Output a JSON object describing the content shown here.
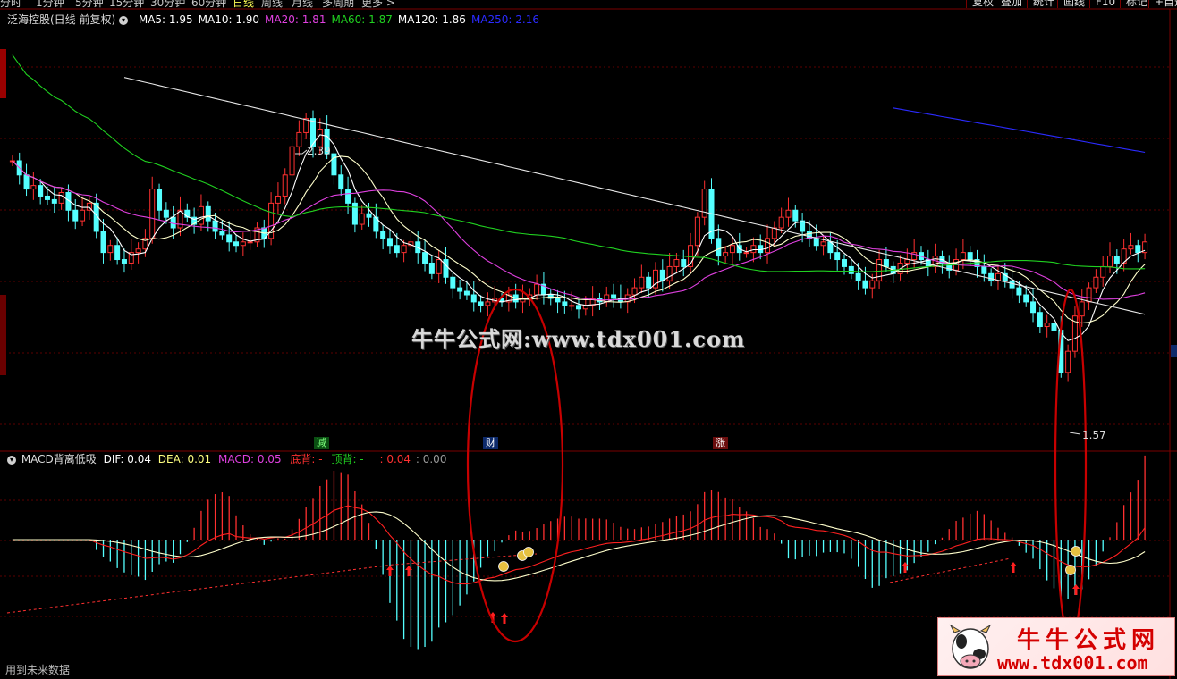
{
  "toolbar": {
    "periods": [
      "分时",
      "1分钟",
      "5分钟",
      "15分钟",
      "30分钟",
      "60分钟",
      "日线",
      "周线",
      "月线",
      "多周期",
      "更多 >"
    ],
    "active_period": "日线",
    "buttons": [
      "复权",
      "叠加",
      "统计",
      "画线",
      "F10",
      "标记",
      "+自选"
    ]
  },
  "main_panel": {
    "title": "泛海控股(日线 前复权)",
    "ma_legend": [
      {
        "label": "MA5: 1.95",
        "color": "#ffffff"
      },
      {
        "label": "MA10: 1.90",
        "color": "#ffffff"
      },
      {
        "label": "MA20: 1.81",
        "color": "#e040e0"
      },
      {
        "label": "MA60: 1.87",
        "color": "#20d020"
      },
      {
        "label": "MA120: 1.86",
        "color": "#ffffff"
      },
      {
        "label": "MA250: 2.16",
        "color": "#2b2bff"
      }
    ],
    "high_label": "2.39",
    "low_label": "1.57",
    "signals": [
      {
        "text": "减",
        "bg": "#0a4f12",
        "color": "#7dff7d"
      },
      {
        "text": "财",
        "bg": "#0d2a6b",
        "color": "#ffffff"
      },
      {
        "text": "涨",
        "bg": "#6b0d0d",
        "color": "#ffffff"
      }
    ]
  },
  "macd_panel": {
    "title": "MACD背离低吸",
    "dif": "DIF: 0.04",
    "dea": "DEA: 0.01",
    "macd": "MACD: 0.05",
    "bottom_div": "底背: -",
    "top_div": "顶背: -",
    "value_red": ": 0.04",
    "value_gray": ": 0.00"
  },
  "footer": {
    "text": "用到未来数据"
  },
  "watermark": {
    "center": "牛牛公式网:www.tdx001.com",
    "logo_title": "牛牛公式网",
    "logo_url": "www.tdx001.com"
  },
  "colors": {
    "up": "#ff3030",
    "down": "#54ffff",
    "ma5": "#ffffff",
    "ma10": "#ffffcc",
    "ma20": "#e040e0",
    "ma60": "#20d020",
    "ma120": "#e8e8e8",
    "ma250": "#2b2bff",
    "grid": "#7a0000",
    "ellipse": "#c80000"
  },
  "chart_data": {
    "type": "candlestick",
    "title": "泛海控股(日线 前复权)",
    "price_labels": {
      "high": 2.39,
      "low": 1.57
    },
    "ma_latest": {
      "MA5": 1.95,
      "MA10": 1.9,
      "MA20": 1.81,
      "MA60": 1.87,
      "MA120": 1.86,
      "MA250": 2.16
    },
    "macd_latest": {
      "DIF": 0.04,
      "DEA": 0.01,
      "MACD": 0.05
    },
    "closes": [
      2.22,
      2.18,
      2.14,
      2.15,
      2.12,
      2.11,
      2.1,
      2.13,
      2.08,
      2.05,
      2.08,
      2.1,
      2.02,
      1.96,
      1.98,
      1.94,
      1.93,
      1.96,
      1.97,
      2.0,
      2.14,
      2.08,
      2.06,
      2.03,
      2.08,
      2.06,
      2.04,
      2.09,
      2.05,
      2.02,
      2.01,
      1.99,
      1.98,
      1.99,
      1.99,
      2.03,
      2.0,
      2.1,
      2.12,
      2.18,
      2.26,
      2.3,
      2.34,
      2.26,
      2.31,
      2.24,
      2.18,
      2.14,
      2.1,
      2.04,
      2.07,
      2.06,
      2.02,
      2.0,
      1.98,
      1.96,
      1.98,
      1.99,
      1.96,
      1.93,
      1.9,
      1.94,
      1.89,
      1.86,
      1.85,
      1.84,
      1.82,
      1.81,
      1.82,
      1.83,
      1.82,
      1.84,
      1.82,
      1.83,
      1.84,
      1.87,
      1.84,
      1.83,
      1.82,
      1.81,
      1.81,
      1.8,
      1.81,
      1.83,
      1.82,
      1.84,
      1.83,
      1.82,
      1.84,
      1.86,
      1.89,
      1.86,
      1.91,
      1.88,
      1.92,
      1.94,
      1.92,
      1.98,
      2.06,
      2.14,
      2.0,
      1.95,
      1.96,
      1.98,
      1.96,
      1.96,
      1.98,
      1.96,
      2.0,
      2.03,
      2.06,
      2.08,
      2.05,
      2.02,
      2.0,
      1.98,
      1.99,
      1.96,
      1.94,
      1.92,
      1.9,
      1.88,
      1.86,
      1.88,
      1.94,
      1.92,
      1.9,
      1.93,
      1.94,
      1.96,
      1.94,
      1.92,
      1.95,
      1.93,
      1.91,
      1.94,
      1.96,
      1.94,
      1.92,
      1.9,
      1.88,
      1.9,
      1.88,
      1.86,
      1.84,
      1.82,
      1.79,
      1.75,
      1.76,
      1.74,
      1.62,
      1.68,
      1.78,
      1.82,
      1.86,
      1.89,
      1.92,
      1.95,
      1.93,
      1.97,
      1.98,
      1.96,
      1.99
    ],
    "x_labels": [],
    "series_names": [
      "MA5",
      "MA10",
      "MA20",
      "MA60",
      "MA120",
      "MA250",
      "DIF",
      "DEA",
      "MACD"
    ]
  }
}
